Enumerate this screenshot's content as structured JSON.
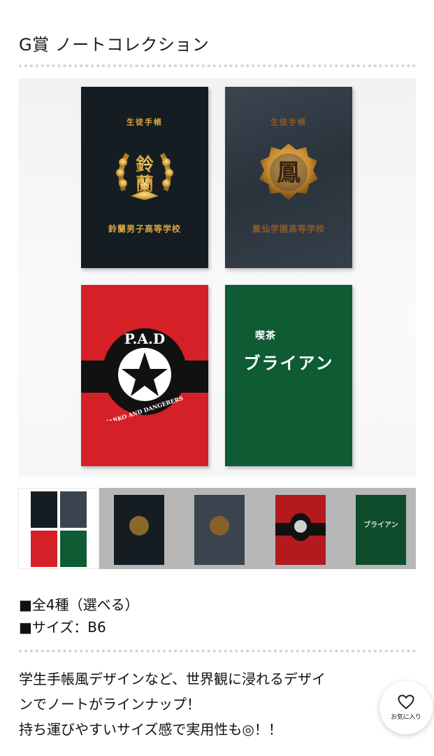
{
  "header": {
    "title": "G賞 ノートコレクション"
  },
  "notebooks": [
    {
      "label_top": "生徒手帳",
      "school": "鈴蘭男子高等学校",
      "emblem_text": "鈴蘭",
      "color": "#151d22"
    },
    {
      "label_top": "生徒手帳",
      "school": "鳳仙学園高等学校",
      "emblem_text": "鳳",
      "color": "#2f3943"
    },
    {
      "emblem_text": "P.A.D",
      "ring_text": "PARKO AND DANGERERS",
      "color": "#d62027"
    },
    {
      "kissa": "喫茶",
      "brian": "ブライアン",
      "color": "#0f5b34"
    }
  ],
  "zoom_button": {
    "icon": "search-icon"
  },
  "specs": [
    "■全4種（選べる）",
    "■サイズ：B6"
  ],
  "description": [
    "学生手帳風デザインなど、世界観に浸れるデザイ",
    "ンでノートがラインナップ！",
    "持ち運びやすいサイズ感で実用性も◎！！"
  ],
  "favorite": {
    "label": "お気に入り",
    "icon": "heart-icon"
  },
  "colors": {
    "gold": "#d9a740",
    "red": "#d62027",
    "green": "#0f5b34",
    "dotted": "#d4d4d4"
  }
}
